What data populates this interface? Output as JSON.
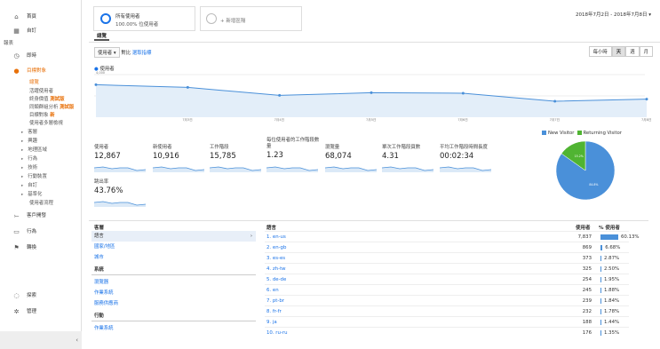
{
  "sidebar": {
    "home": "首頁",
    "custom": "自訂",
    "reports_heading": "報表",
    "realtime": "即時",
    "audience": "目標對象",
    "aud_items": [
      {
        "label": "總覽",
        "active": true
      },
      {
        "label": "活躍使用者",
        "tag": ""
      },
      {
        "label": "終身價值",
        "tag": "測試版"
      },
      {
        "label": "同類群組分析",
        "tag": "測試版"
      },
      {
        "label": "目標對象",
        "tag": "新"
      },
      {
        "label": "使用者多層檢視",
        "tag": ""
      }
    ],
    "aud_groups": [
      "客層",
      "興趣",
      "地理區域",
      "行為",
      "技術",
      "行動裝置",
      "自訂",
      "基準化"
    ],
    "user_flow": "使用者流程",
    "acquisition": "客戶開發",
    "behavior": "行為",
    "conversions": "轉換",
    "discover": "探索",
    "admin": "管理",
    "collapse": "‹"
  },
  "segment": {
    "title": "所有使用者",
    "subtitle": "100.00% 位使用者",
    "add": "+ 新增區隔"
  },
  "date_range": "2018年7月2日 - 2018年7月8日",
  "overview_tab": "總覽",
  "controls": {
    "metric": "使用者",
    "vs": "對比",
    "select_metric": "選取指標",
    "granularity": [
      "每小時",
      "天",
      "週",
      "月"
    ],
    "granularity_selected": "天"
  },
  "chart": {
    "series_label": "使用者",
    "y_ticks": [
      "4,000",
      "2,000"
    ],
    "x_labels": [
      "7月3日",
      "7月4日",
      "7月5日",
      "7月6日",
      "7月7日",
      "7月8日"
    ]
  },
  "chart_data": {
    "type": "area",
    "x": [
      "7月2日",
      "7月3日",
      "7月4日",
      "7月5日",
      "7月6日",
      "7月7日",
      "7月8日"
    ],
    "series": [
      {
        "name": "使用者",
        "values": [
          3050,
          2800,
          2050,
          2300,
          2250,
          1500,
          1700
        ]
      }
    ],
    "ylim": [
      0,
      4000
    ]
  },
  "metrics": [
    {
      "label": "使用者",
      "value": "12,867"
    },
    {
      "label": "新使用者",
      "value": "10,916"
    },
    {
      "label": "工作階段",
      "value": "15,785"
    },
    {
      "label": "每位使用者的工作階段數量",
      "value": "1.23"
    },
    {
      "label": "瀏覽量",
      "value": "68,074"
    },
    {
      "label": "單次工作階段頁數",
      "value": "4.31"
    },
    {
      "label": "平均工作階段時間長度",
      "value": "00:02:34"
    },
    {
      "label": "跳出率",
      "value": "43.76%"
    }
  ],
  "pie": {
    "legend": [
      {
        "name": "New Visitor",
        "color": "#4a90d9"
      },
      {
        "name": "Returning Visitor",
        "color": "#50b432"
      }
    ],
    "new_pct": "84.8%",
    "returning_pct": "15.2%",
    "new_value": 84.8,
    "returning_value": 15.2
  },
  "dimensions": {
    "header": "客層",
    "items": [
      {
        "label": "語言",
        "selected": true
      },
      {
        "label": "國家/地區"
      },
      {
        "label": "城市"
      }
    ],
    "system_header": "系統",
    "system_items": [
      "瀏覽器",
      "作業系統",
      "服務供應商"
    ],
    "mobile_header": "行動",
    "mobile_items": [
      "作業系統"
    ]
  },
  "lang_table": {
    "header": "語言",
    "users_header": "使用者",
    "pct_header": "% 使用者",
    "rows": [
      {
        "n": "1.",
        "name": "en-us",
        "users": "7,837",
        "pct": "60.13%",
        "v": 60.13
      },
      {
        "n": "2.",
        "name": "en-gb",
        "users": "869",
        "pct": "6.68%",
        "v": 6.68
      },
      {
        "n": "3.",
        "name": "es-es",
        "users": "373",
        "pct": "2.87%",
        "v": 2.87
      },
      {
        "n": "4.",
        "name": "zh-tw",
        "users": "325",
        "pct": "2.50%",
        "v": 2.5
      },
      {
        "n": "5.",
        "name": "de-de",
        "users": "254",
        "pct": "1.95%",
        "v": 1.95
      },
      {
        "n": "6.",
        "name": "en",
        "users": "245",
        "pct": "1.88%",
        "v": 1.88
      },
      {
        "n": "7.",
        "name": "pt-br",
        "users": "239",
        "pct": "1.84%",
        "v": 1.84
      },
      {
        "n": "8.",
        "name": "fr-fr",
        "users": "232",
        "pct": "1.78%",
        "v": 1.78
      },
      {
        "n": "9.",
        "name": "ja",
        "users": "188",
        "pct": "1.44%",
        "v": 1.44
      },
      {
        "n": "10.",
        "name": "ru-ru",
        "users": "176",
        "pct": "1.35%",
        "v": 1.35
      }
    ]
  }
}
